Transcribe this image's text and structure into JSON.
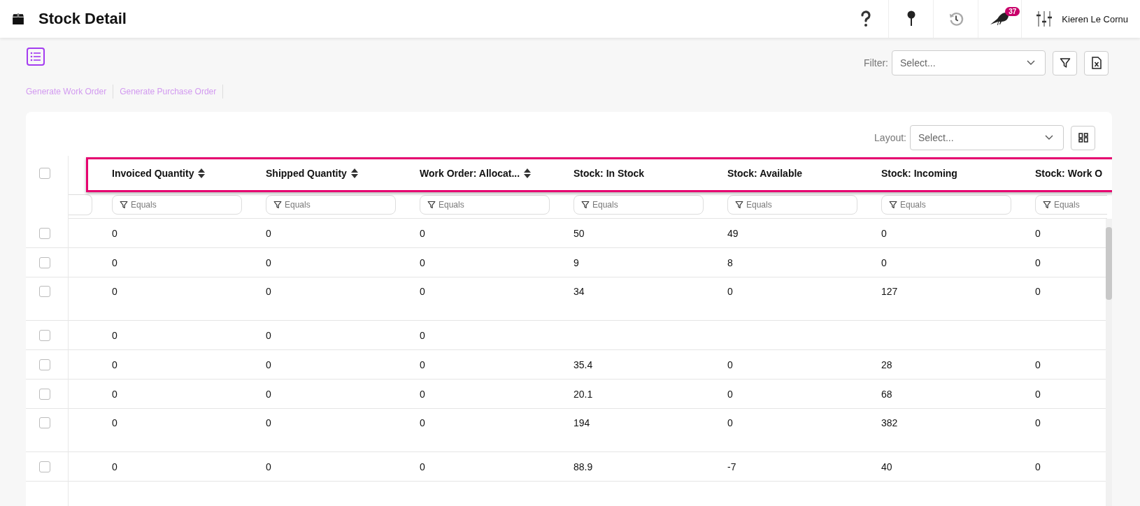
{
  "header": {
    "title": "Stock Detail",
    "notification_count": "37",
    "user_name": "Kieren Le Cornu"
  },
  "actions": [
    "Generate Work Order",
    "Generate Purchase Order"
  ],
  "filter": {
    "label": "Filter:",
    "placeholder": "Select..."
  },
  "layout": {
    "label": "Layout:",
    "placeholder": "Select..."
  },
  "table": {
    "select_all": {
      "checked": false
    },
    "columns": [
      {
        "label": "Invoiced Quantity",
        "sortable": true,
        "filter_placeholder": "Equals"
      },
      {
        "label": "Shipped Quantity",
        "sortable": true,
        "filter_placeholder": "Equals"
      },
      {
        "label": "Work Order: Allocat...",
        "sortable": true,
        "filter_placeholder": "Equals"
      },
      {
        "label": "Stock: In Stock",
        "sortable": false,
        "filter_placeholder": "Equals"
      },
      {
        "label": "Stock: Available",
        "sortable": false,
        "filter_placeholder": "Equals"
      },
      {
        "label": "Stock: Incoming",
        "sortable": false,
        "filter_placeholder": "Equals"
      },
      {
        "label": "Stock: Work O",
        "filter_placeholder": "Equals"
      }
    ],
    "rows": [
      {
        "checked": false,
        "tall": false,
        "cells": [
          "0",
          "0",
          "0",
          "50",
          "49",
          "0",
          "0"
        ]
      },
      {
        "checked": false,
        "tall": false,
        "cells": [
          "0",
          "0",
          "0",
          "9",
          "8",
          "0",
          "0"
        ]
      },
      {
        "checked": false,
        "tall": true,
        "cells": [
          "0",
          "0",
          "0",
          "34",
          "0",
          "127",
          "0"
        ]
      },
      {
        "checked": false,
        "tall": false,
        "cells": [
          "0",
          "0",
          "0"
        ]
      },
      {
        "checked": false,
        "tall": false,
        "cells": [
          "0",
          "0",
          "0",
          "35.4",
          "0",
          "28",
          "0"
        ]
      },
      {
        "checked": false,
        "tall": false,
        "cells": [
          "0",
          "0",
          "0",
          "20.1",
          "0",
          "68",
          "0"
        ]
      },
      {
        "checked": false,
        "tall": true,
        "cells": [
          "0",
          "0",
          "0",
          "194",
          "0",
          "382",
          "0"
        ]
      },
      {
        "checked": false,
        "tall": false,
        "cells": [
          "0",
          "0",
          "0",
          "88.9",
          "-7",
          "40",
          "0"
        ]
      }
    ]
  }
}
